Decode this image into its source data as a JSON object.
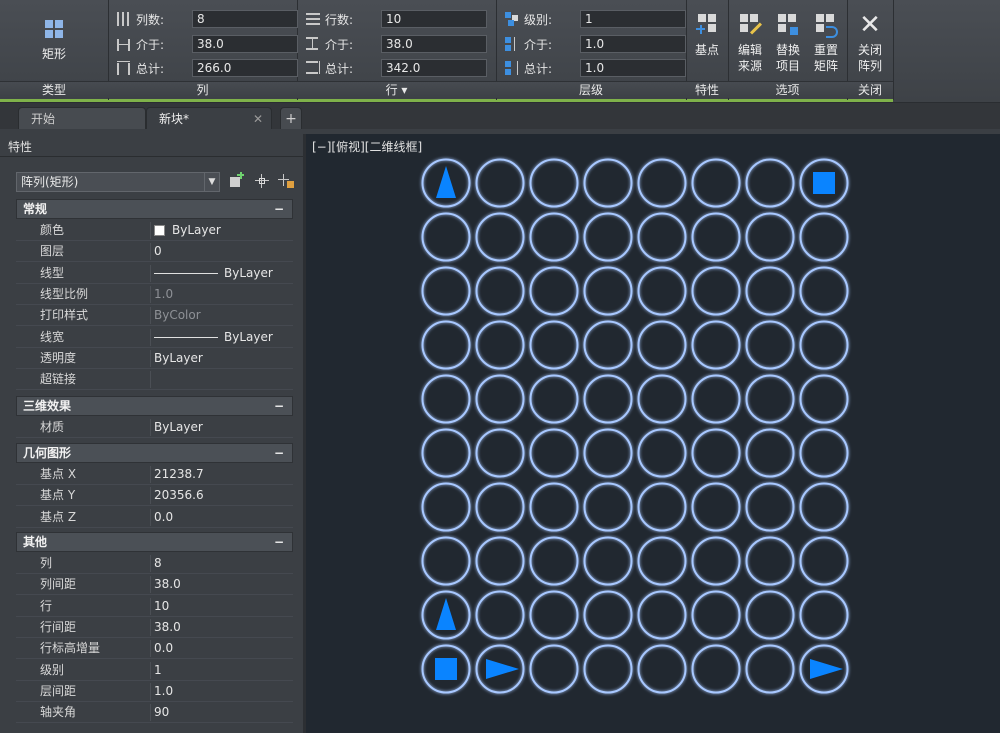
{
  "ribbon": {
    "type_panel": {
      "button": "矩形",
      "title": "类型"
    },
    "columns_panel": {
      "title": "列",
      "rows": [
        {
          "label": "列数:",
          "value": "8"
        },
        {
          "label": "介于:",
          "value": "38.0"
        },
        {
          "label": "总计:",
          "value": "266.0"
        }
      ]
    },
    "rows_panel": {
      "title": "行 ▾",
      "rows": [
        {
          "label": "行数:",
          "value": "10"
        },
        {
          "label": "介于:",
          "value": "38.0"
        },
        {
          "label": "总计:",
          "value": "342.0"
        }
      ]
    },
    "levels_panel": {
      "title": "层级",
      "rows": [
        {
          "label": "级别:",
          "value": "1"
        },
        {
          "label": "介于:",
          "value": "1.0"
        },
        {
          "label": "总计:",
          "value": "1.0"
        }
      ]
    },
    "properties_panel": {
      "button": "基点",
      "title": "特性"
    },
    "options_panel": {
      "title": "选项",
      "edit_source": [
        "编辑",
        "来源"
      ],
      "replace_item": [
        "替换",
        "项目"
      ],
      "reset_matrix": [
        "重置",
        "矩阵"
      ]
    },
    "close_panel": {
      "button": [
        "关闭",
        "阵列"
      ],
      "title": "关闭"
    }
  },
  "tabs": [
    {
      "label": "开始"
    },
    {
      "label": "新块*",
      "close": "✕"
    },
    {
      "label": "+"
    }
  ],
  "properties": {
    "title": "特性",
    "selector": "阵列(矩形)",
    "sections": [
      {
        "title": "常规",
        "toggle": "−",
        "rows": [
          {
            "label": "颜色",
            "value": "ByLayer",
            "kind": "swatch"
          },
          {
            "label": "图层",
            "value": "0"
          },
          {
            "label": "线型",
            "value": "ByLayer",
            "kind": "line"
          },
          {
            "label": "线型比例",
            "value": "1.0",
            "dim": true
          },
          {
            "label": "打印样式",
            "value": "ByColor",
            "dim": true
          },
          {
            "label": "线宽",
            "value": "ByLayer",
            "kind": "line"
          },
          {
            "label": "透明度",
            "value": "ByLayer"
          },
          {
            "label": "超链接",
            "value": ""
          }
        ]
      },
      {
        "title": "三维效果",
        "toggle": "−",
        "rows": [
          {
            "label": "材质",
            "value": "ByLayer"
          }
        ]
      },
      {
        "title": "几何图形",
        "toggle": "−",
        "rows": [
          {
            "label": "基点 X",
            "value": "21238.7"
          },
          {
            "label": "基点 Y",
            "value": "20356.6"
          },
          {
            "label": "基点 Z",
            "value": "0.0"
          }
        ]
      },
      {
        "title": "其他",
        "toggle": "−",
        "rows": [
          {
            "label": "列",
            "value": "8"
          },
          {
            "label": "列间距",
            "value": "38.0"
          },
          {
            "label": "行",
            "value": "10"
          },
          {
            "label": "行间距",
            "value": "38.0"
          },
          {
            "label": "行标高增量",
            "value": "0.0"
          },
          {
            "label": "级别",
            "value": "1"
          },
          {
            "label": "层间距",
            "value": "1.0"
          },
          {
            "label": "轴夹角",
            "value": "90"
          }
        ]
      }
    ]
  },
  "viewport": {
    "label": "[−][俯视][二维线框]",
    "array": {
      "columns": 8,
      "rows": 10,
      "circle_color": "#a8c8ff",
      "marker_color": "#0a84ff",
      "markers": [
        {
          "row": 0,
          "col": 0,
          "shape": "triangle-up"
        },
        {
          "row": 0,
          "col": 7,
          "shape": "square"
        },
        {
          "row": 8,
          "col": 0,
          "shape": "triangle-up"
        },
        {
          "row": 9,
          "col": 0,
          "shape": "square"
        },
        {
          "row": 9,
          "col": 1,
          "shape": "triangle-right"
        },
        {
          "row": 9,
          "col": 7,
          "shape": "triangle-right"
        }
      ]
    }
  }
}
